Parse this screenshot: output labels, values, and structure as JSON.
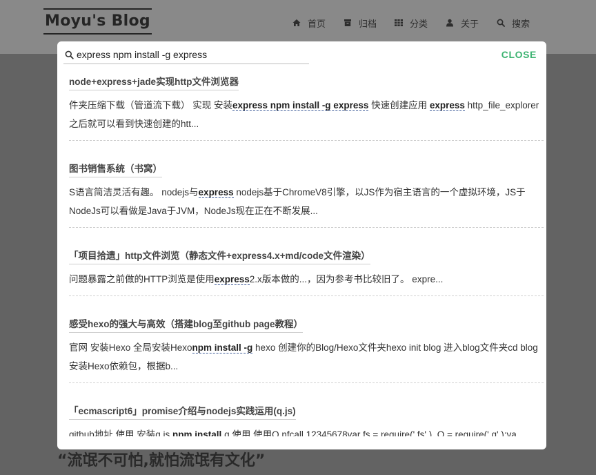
{
  "site": {
    "logo": "Moyu's Blog",
    "nav": [
      {
        "label": "首页",
        "icon": "home-icon"
      },
      {
        "label": "归档",
        "icon": "archive-icon"
      },
      {
        "label": "分类",
        "icon": "grid-icon"
      },
      {
        "label": "关于",
        "icon": "user-icon"
      },
      {
        "label": "搜索",
        "icon": "search-icon"
      }
    ],
    "quote": "“流氓不可怕,就怕流氓有文化”"
  },
  "search": {
    "value": "express npm install -g express",
    "close_label": "CLOSE",
    "accent": "#3cb371"
  },
  "results": [
    {
      "title": "node+express+jade实现http文件浏览器",
      "snippet": [
        {
          "t": "件夹压缩下载（管道流下载） 实现 安装"
        },
        {
          "t": "express npm install -g express",
          "h": true
        },
        {
          "t": " 快速创建应用 "
        },
        {
          "t": "express",
          "h": true
        },
        {
          "t": " http_file_explorer 之后就可以看到快速创建的htt..."
        }
      ]
    },
    {
      "title": "图书销售系统（书窝）",
      "snippet": [
        {
          "t": "S语言简洁灵活有趣。 nodejs与"
        },
        {
          "t": "express",
          "h": true
        },
        {
          "t": " nodejs基于ChromeV8引擎，以JS作为宿主语言的一个虚拟环境，JS于NodeJs可以看做是Java于JVM，NodeJs现在正在不断发展..."
        }
      ]
    },
    {
      "title": "「项目拾遗」http文件浏览（静态文件+express4.x+md/code文件渲染）",
      "snippet": [
        {
          "t": "问题暴露之前做的HTTP浏览是使用"
        },
        {
          "t": "express",
          "h": true
        },
        {
          "t": "2.x版本做的...，因为参考书比较旧了。 expre..."
        }
      ]
    },
    {
      "title": "感受hexo的强大与高效（搭建blog至github page教程）",
      "snippet": [
        {
          "t": "官网 安装Hexo 全局安装Hexo"
        },
        {
          "t": "npm install -g",
          "h": true
        },
        {
          "t": " hexo 创建你的Blog/Hexo文件夹hexo init blog 进入blog文件夹cd blog 安装Hexo依赖包，根据b..."
        }
      ]
    },
    {
      "title": "「ecmascript6」promise介绍与nodejs实践运用(q.js)",
      "snippet": [
        {
          "t": "github地址 使用 安装q.js "
        },
        {
          "t": "npm install",
          "h": true
        },
        {
          "t": " q 使用 使用Q.nfcall 12345678var fs = require(' fs' ), Q = require(' q' );va..."
        }
      ]
    }
  ]
}
